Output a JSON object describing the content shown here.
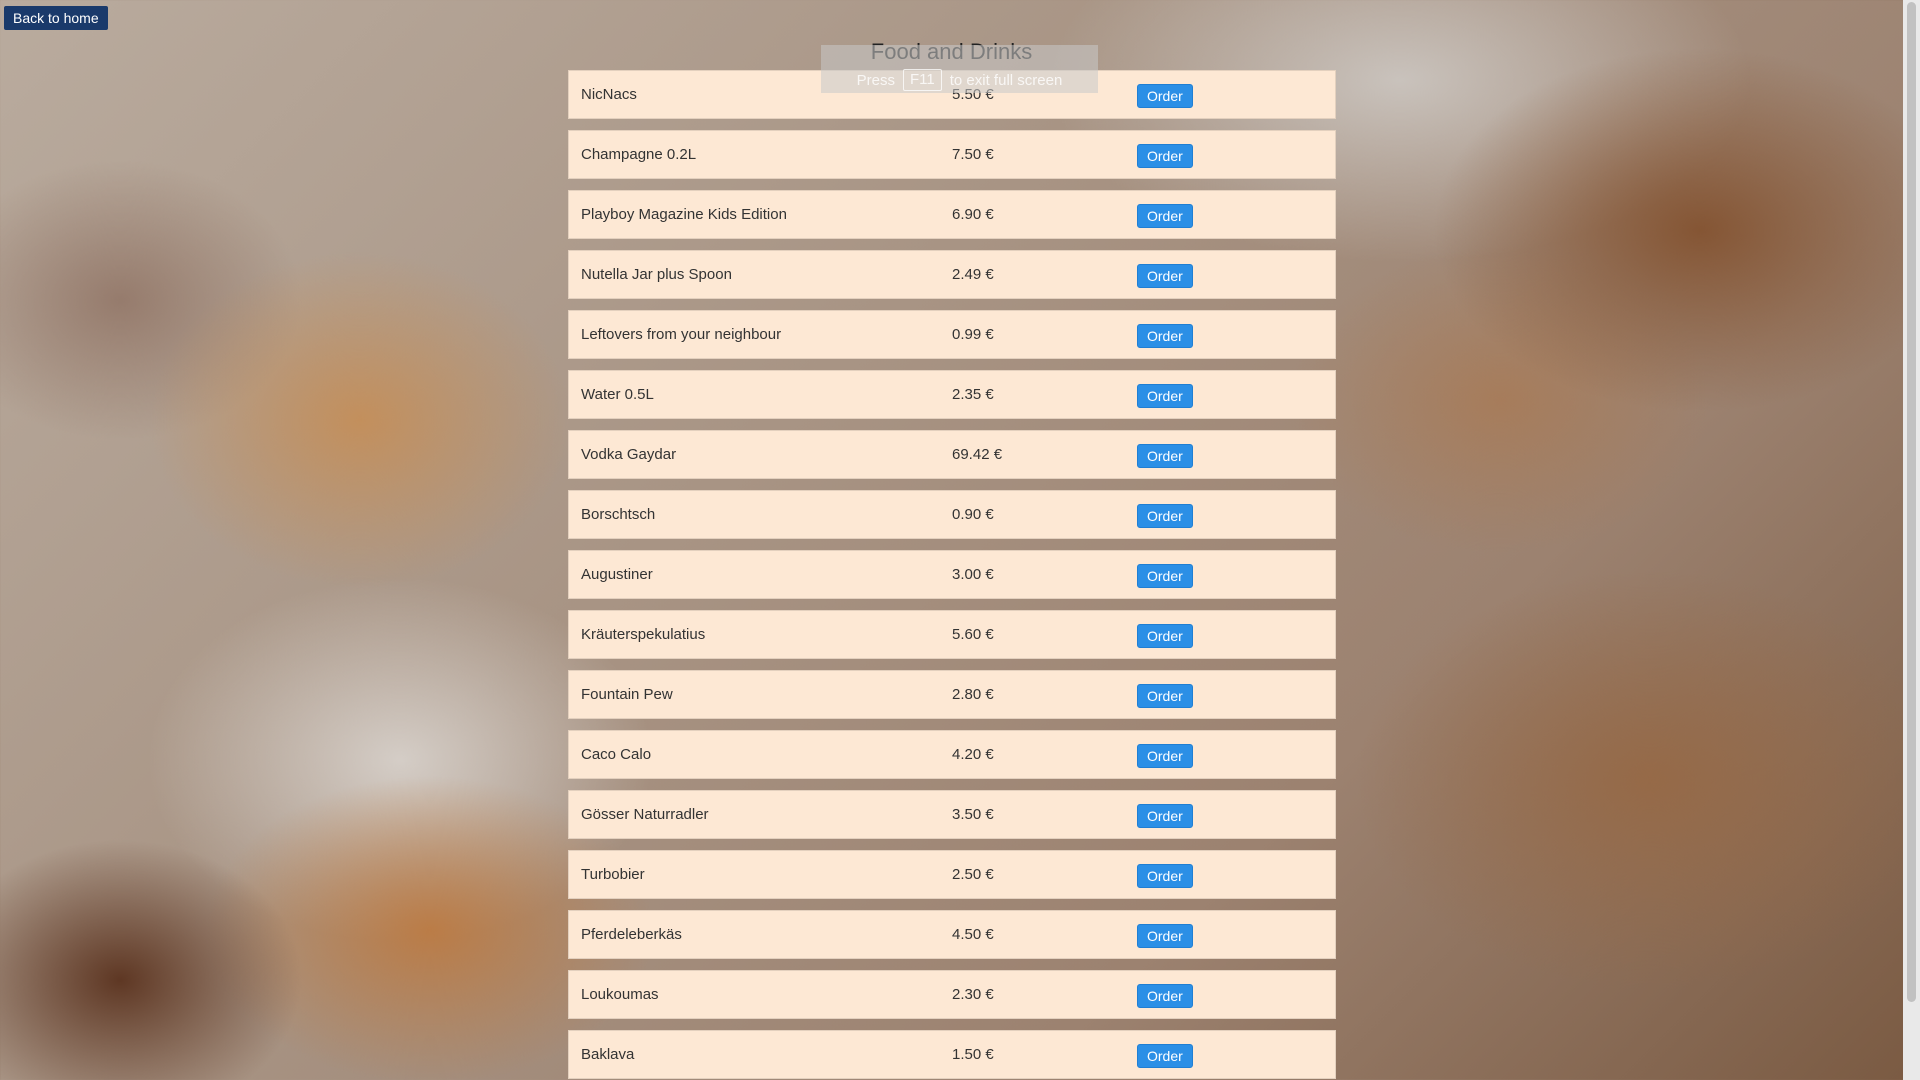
{
  "nav": {
    "back_label": "Back to home"
  },
  "header": {
    "title": "Food and Drinks"
  },
  "fullscreen_notice": {
    "prefix": "Press",
    "key": "F11",
    "suffix": "to exit full screen"
  },
  "menu": {
    "items": [
      {
        "name": "NicNacs",
        "price": "5.50 €",
        "button": "Order"
      },
      {
        "name": "Champagne 0.2L",
        "price": "7.50 €",
        "button": "Order"
      },
      {
        "name": "Playboy Magazine Kids Edition",
        "price": "6.90 €",
        "button": "Order"
      },
      {
        "name": "Nutella Jar plus Spoon",
        "price": "2.49 €",
        "button": "Order"
      },
      {
        "name": "Leftovers from your neighbour",
        "price": "0.99 €",
        "button": "Order"
      },
      {
        "name": "Water 0.5L",
        "price": "2.35 €",
        "button": "Order"
      },
      {
        "name": "Vodka Gaydar",
        "price": "69.42 €",
        "button": "Order"
      },
      {
        "name": "Borschtsch",
        "price": "0.90 €",
        "button": "Order"
      },
      {
        "name": "Augustiner",
        "price": "3.00 €",
        "button": "Order"
      },
      {
        "name": "Kräuterspekulatius",
        "price": "5.60 €",
        "button": "Order"
      },
      {
        "name": "Fountain Pew",
        "price": "2.80 €",
        "button": "Order"
      },
      {
        "name": "Caco Calo",
        "price": "4.20 €",
        "button": "Order"
      },
      {
        "name": "Gösser Naturradler",
        "price": "3.50 €",
        "button": "Order"
      },
      {
        "name": "Turbobier",
        "price": "2.50 €",
        "button": "Order"
      },
      {
        "name": "Pferdeleberkäs",
        "price": "4.50 €",
        "button": "Order"
      },
      {
        "name": "Loukoumas",
        "price": "2.30 €",
        "button": "Order"
      },
      {
        "name": "Baklava",
        "price": "1.50 €",
        "button": "Order"
      }
    ]
  }
}
